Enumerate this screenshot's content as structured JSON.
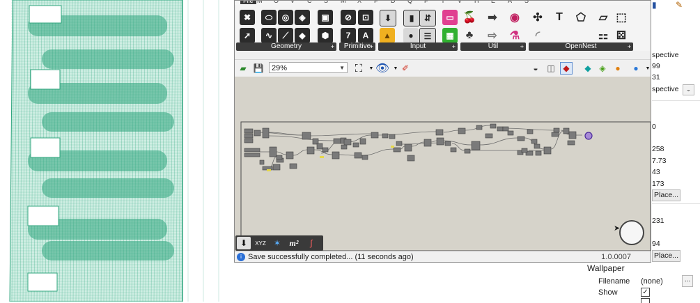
{
  "grasshopper": {
    "menu_items": [
      "File",
      "M",
      "O",
      "V",
      "C",
      "S",
      "M",
      "X",
      "F",
      "D",
      "Q",
      "F",
      "Y",
      "V",
      "H",
      "E",
      "A",
      "S"
    ],
    "ribbon_groups": [
      {
        "label": "Geometry"
      },
      {
        "label": "Primitive"
      },
      {
        "label": "Input"
      },
      {
        "label": "Util"
      },
      {
        "label": "OpenNest"
      }
    ],
    "toolbar": {
      "zoom": "29%"
    },
    "bottom_bar": {
      "xyz_label": "XYZ",
      "area_label": "m²"
    },
    "status": {
      "message": "Save successfully completed... (11 seconds ago)",
      "version": "1.0.0007"
    }
  },
  "properties_panel": {
    "rows": [
      "spective",
      "99",
      "31",
      "spective",
      "0",
      "258",
      "7.73",
      "43",
      "173",
      "231",
      "94"
    ],
    "place_button_1": "Place...",
    "place_button_2": "Place...",
    "dropdown_glyph": "⌄"
  },
  "wallpaper": {
    "title": "Wallpaper",
    "filename_label": "Filename",
    "filename_value": "(none)",
    "ellipsis_button": "...",
    "show_label": "Show",
    "show_checked": true,
    "show_check_glyph": "✓"
  },
  "colors": {
    "mesh_green": "#2fa57e",
    "canvas_bg": "#d6d3ca",
    "component_grey": "#7a7a7a",
    "ribbon_label_bg": "#3b3b3b"
  }
}
